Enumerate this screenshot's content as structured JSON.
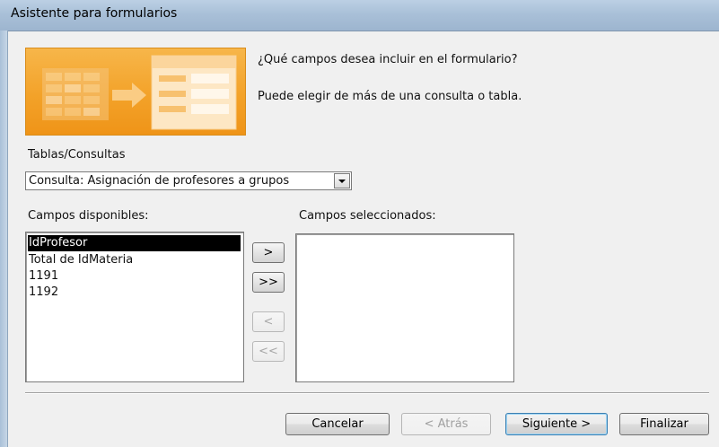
{
  "window": {
    "title": "Asistente para formularios"
  },
  "intro": {
    "question": "¿Qué campos desea incluir en el formulario?",
    "hint": "Puede elegir de más de una consulta o tabla."
  },
  "source": {
    "label": "Tablas/Consultas",
    "selected": "Consulta: Asignación de profesores a grupos"
  },
  "available": {
    "label": "Campos disponibles:",
    "items": [
      "IdProfesor",
      "Total de IdMateria",
      "1191",
      "1192"
    ],
    "selected_index": 0
  },
  "selected_fields": {
    "label": "Campos seleccionados:",
    "items": []
  },
  "move_buttons": {
    "add_one": ">",
    "add_all": ">>",
    "remove_one": "<",
    "remove_all": "<<"
  },
  "footer": {
    "cancel": "Cancelar",
    "back": "< Atrás",
    "next": "Siguiente >",
    "finish": "Finalizar"
  },
  "colors": {
    "title_bar": "#a9c0d8",
    "wizard_art": "#f3a229",
    "selection": "#000000"
  }
}
